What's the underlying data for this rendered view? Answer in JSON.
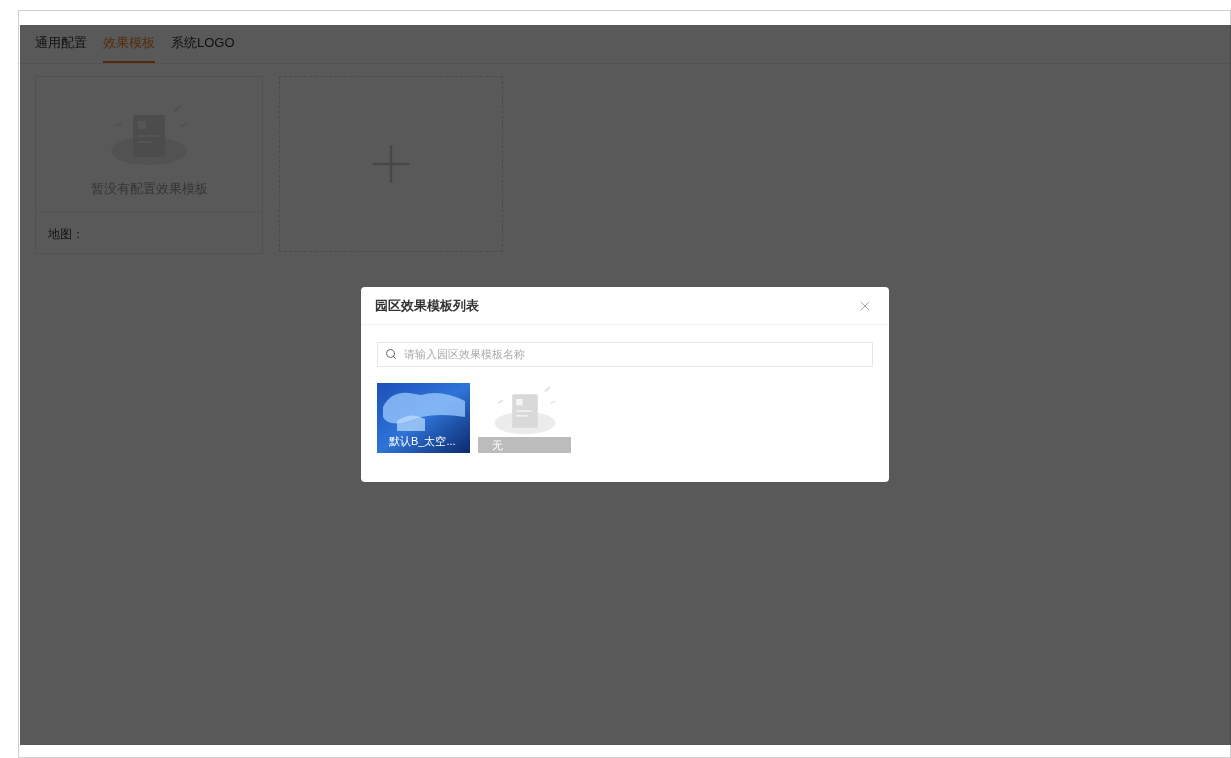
{
  "tabs": [
    {
      "label": "通用配置",
      "selected": false
    },
    {
      "label": "效果模板",
      "selected": true
    },
    {
      "label": "系统LOGO",
      "selected": false
    }
  ],
  "template_card": {
    "empty_text": "暂没有配置效果模板",
    "footer": "地图："
  },
  "dialog": {
    "title": "园区效果模板列表",
    "search": {
      "placeholder": "请输入园区效果模板名称"
    },
    "templates": [
      {
        "kind": "image",
        "name": "默认B_太空..."
      },
      {
        "kind": "empty",
        "name": "无"
      }
    ]
  }
}
